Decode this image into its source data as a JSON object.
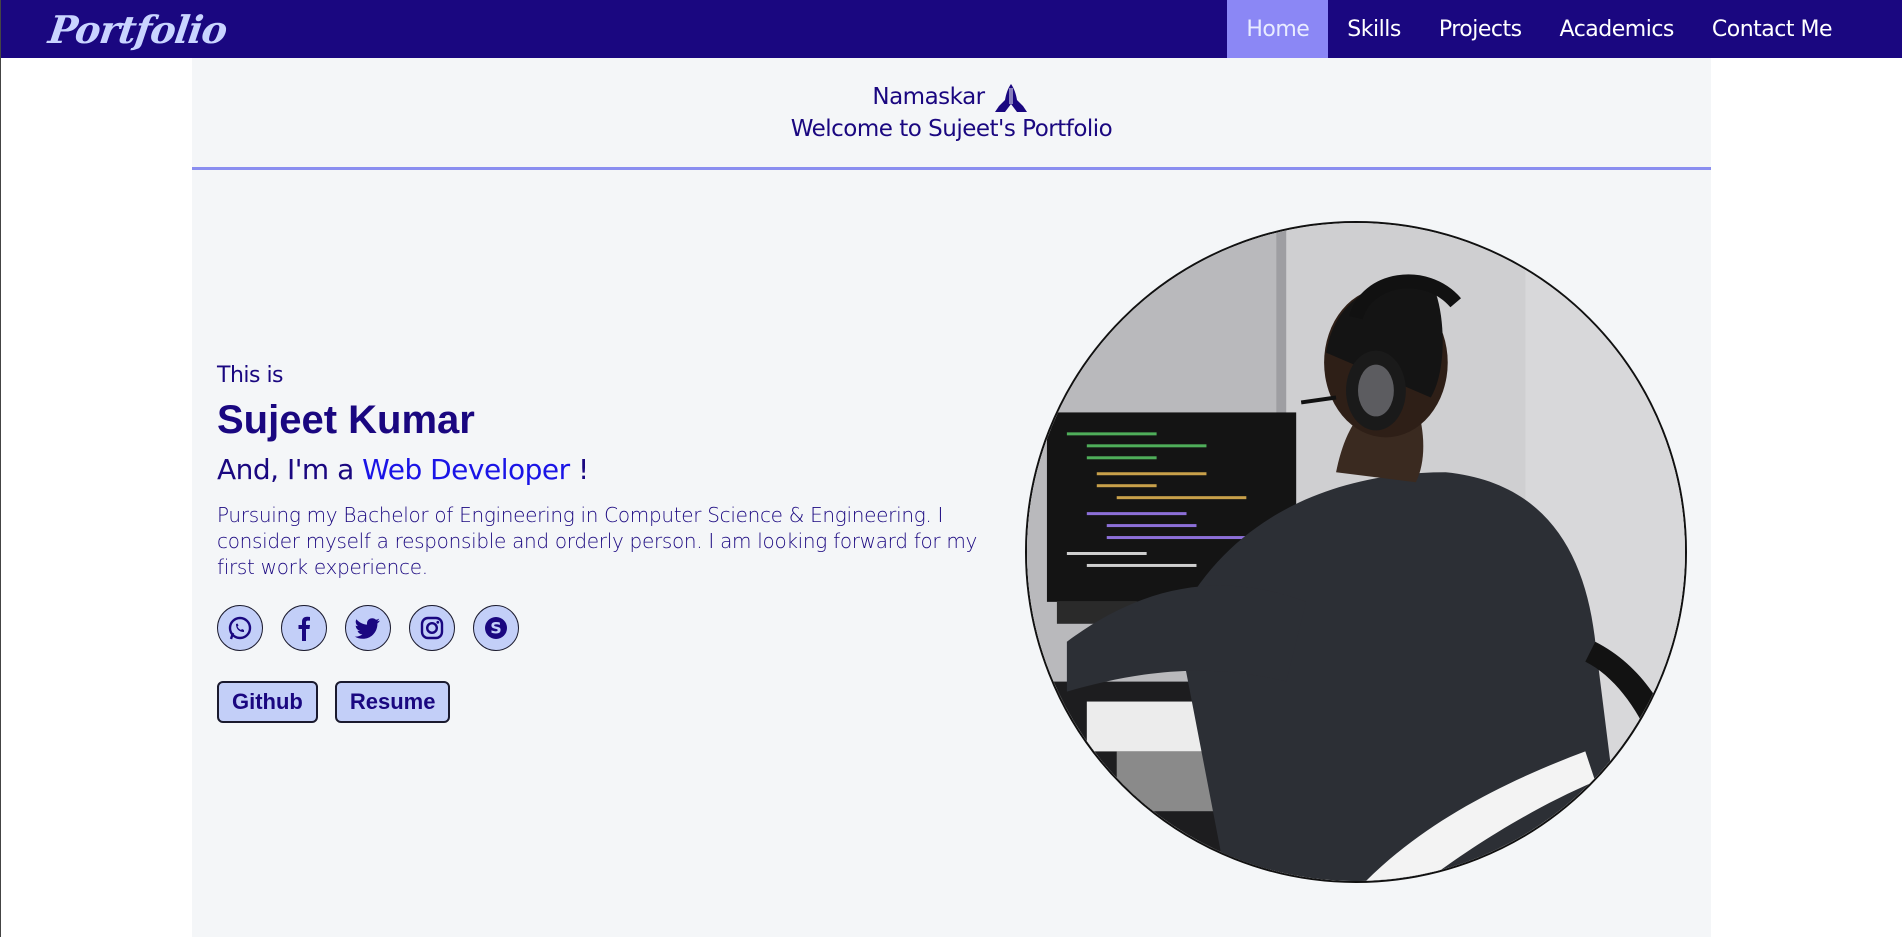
{
  "nav": {
    "logo": "Portfolio",
    "links": [
      "Home",
      "Skills",
      "Projects",
      "Academics",
      "Contact Me"
    ],
    "active": "Home"
  },
  "welcome": {
    "greeting": "Namaskar",
    "greeting_icon": "namaste-hands-icon",
    "line2": "Welcome to Sujeet's Portfolio"
  },
  "hero": {
    "intro": "This is",
    "name": "Sujeet Kumar",
    "role_prefix": "And, I'm a",
    "role": "Web Developer",
    "role_suffix": "!",
    "description": "Pursuing my Bachelor of Engineering in Computer Science & Engineering. I consider myself a responsible and orderly person. I am looking forward for my first work experience.",
    "socials": [
      "whatsapp-icon",
      "facebook-icon",
      "twitter-icon",
      "instagram-icon",
      "skype-icon"
    ],
    "buttons": {
      "github": "Github",
      "resume": "Resume"
    }
  },
  "colors": {
    "navbar": "#1a0780",
    "active_tab": "#8b87f5",
    "accent_text": "#1a14e6",
    "button_fill": "#c3cff8"
  }
}
